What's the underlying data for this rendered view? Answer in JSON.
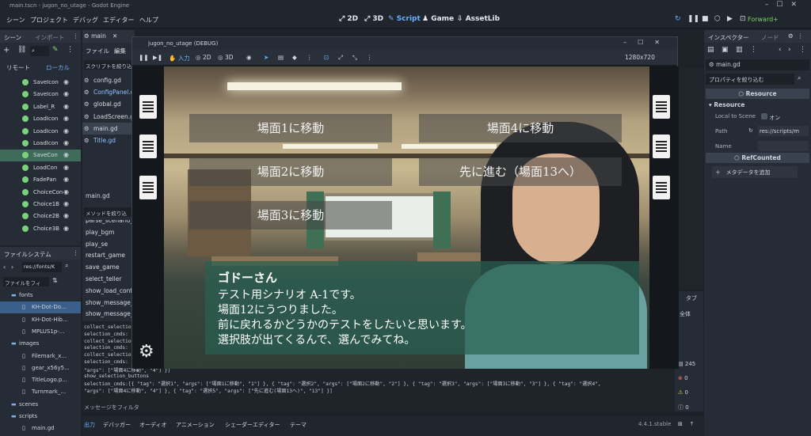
{
  "window": {
    "title": "main.tscn - jugon_no_utage - Godot Engine"
  },
  "menu": [
    "シーン",
    "プロジェクト",
    "デバッグ",
    "エディター",
    "ヘルプ"
  ],
  "workspaces": [
    "2D",
    "3D",
    "Script",
    "Game",
    "AssetLib"
  ],
  "workspace_active": "Script",
  "renderer": "Forward+",
  "scene_dock": {
    "tabs": [
      "シーン",
      "インポート"
    ],
    "filter_placeholder": "フィルタ",
    "mode_tabs": [
      "リモート",
      "ローカル"
    ],
    "nodes": [
      {
        "label": "SaveIcon",
        "selected": false
      },
      {
        "label": "SaveIcon",
        "selected": false
      },
      {
        "label": "Label_R",
        "selected": false
      },
      {
        "label": "LoadIcon",
        "selected": false
      },
      {
        "label": "LoadIcon",
        "selected": false
      },
      {
        "label": "LoadIcon",
        "selected": false
      },
      {
        "label": "SaveCon",
        "selected": true
      },
      {
        "label": "LoadCon",
        "selected": false
      },
      {
        "label": "FadePan",
        "selected": false
      },
      {
        "label": "ChoiceCon",
        "selected": false
      },
      {
        "label": "Choice1B",
        "selected": false
      },
      {
        "label": "Choice2B",
        "selected": false
      },
      {
        "label": "Choice3B",
        "selected": false
      }
    ]
  },
  "filesystem": {
    "title": "ファイルシステム",
    "path": "res://fonts/K",
    "filter_placeholder": "ファイルをフィ",
    "items": [
      {
        "label": "fonts",
        "indent": 1
      },
      {
        "label": "KH-Dot-Do...",
        "indent": 2,
        "selected": true
      },
      {
        "label": "KH-Dot-Hib...",
        "indent": 2
      },
      {
        "label": "MPLUS1p-...",
        "indent": 2
      },
      {
        "label": "images",
        "indent": 1
      },
      {
        "label": "Filemark_x...",
        "indent": 2
      },
      {
        "label": "gear_x56y5...",
        "indent": 2
      },
      {
        "label": "TitleLogo.p...",
        "indent": 2
      },
      {
        "label": "Turnmark_...",
        "indent": 2
      },
      {
        "label": "scenes",
        "indent": 1
      },
      {
        "label": "scripts",
        "indent": 1
      },
      {
        "label": "main.gd",
        "indent": 2
      }
    ]
  },
  "script_panel": {
    "tab": "main",
    "menu": [
      "ファイル",
      "編集"
    ],
    "filter_placeholder": "スクリプトを絞り込",
    "scripts": [
      "config.gd",
      "ConfigPanel.gd",
      "global.gd",
      "LoadScreen.gd",
      "main.gd",
      "Title.gd"
    ],
    "current_script": "main.gd",
    "method_filter_placeholder": "メソッドを絞り込",
    "methods": [
      "parse_scenario_line",
      "play_bgm",
      "play_se",
      "restart_game",
      "save_game",
      "select_teller",
      "show_load_confir",
      "show_message_p",
      "show_message_p"
    ]
  },
  "output": {
    "lines": [
      "collect_selectio",
      "selection_cmds:",
      "collect_selectio",
      "selection_cmds:",
      "collect_selectio",
      "selection_cmds:",
      "\"args\": [\"場面4に移動\", \"4\"] }]",
      "show_selection_buttons",
      "selection_cmds:[{ \"tag\": \"選択1\", \"args\": [\"場面1に移動\", \"1\"] }, { \"tag\": \"選択2\", \"args\": [\"場面2に移動\", \"2\"] }, { \"tag\": \"選択3\", \"args\": [\"場面3に移動\", \"3\"] }, { \"tag\": \"選択4\",",
      "\"args\": [\"場面4に移動\", \"4\"] }, { \"tag\": \"選択5\", \"args\": [\"先に進む(場面13へ)\", \"13\"] }]"
    ],
    "filter_placeholder": "メッセージをフィルタ",
    "counts": {
      "log": "245",
      "errors": "0",
      "warnings": "0",
      "messages": "0"
    }
  },
  "bottom_tabs": [
    "出力",
    "デバッガー",
    "オーディオ",
    "アニメーション",
    "シェーダーエディター",
    "テーマ"
  ],
  "version": "4.4.1.stable",
  "game_window": {
    "title": "jugon_no_utage (DEBUG)",
    "toolbar": [
      "入力",
      "2D",
      "3D"
    ],
    "resolution": "1280x720",
    "choices": [
      "場面1に移動",
      "場面2に移動",
      "場面3に移動",
      "場面4に移動",
      "先に進む（場面13へ）"
    ],
    "speaker": "ゴドーさん",
    "message": [
      "テスト用シナリオ A-1です。",
      "場面12にうつりました。",
      "前に戻れるかどうかのテストをしたいと思います。",
      "選択肢が出てくるんで、選んでみてね。"
    ]
  },
  "inspector": {
    "tabs": [
      "インスペクター",
      "ノード"
    ],
    "file": "main.gd",
    "filter_placeholder": "プロパティを絞り込む",
    "resource_title": "Resource",
    "section": "Resource",
    "local_to_scene_label": "Local to Scene",
    "local_to_scene_value": "オン",
    "path_label": "Path",
    "path_value": "res://scripts/m",
    "name_label": "Name",
    "refcounted_title": "RefCounted",
    "add_metadata": "メタデータを追加"
  },
  "right_strip": {
    "tab_label": "タブ",
    "all_label": "全体"
  }
}
